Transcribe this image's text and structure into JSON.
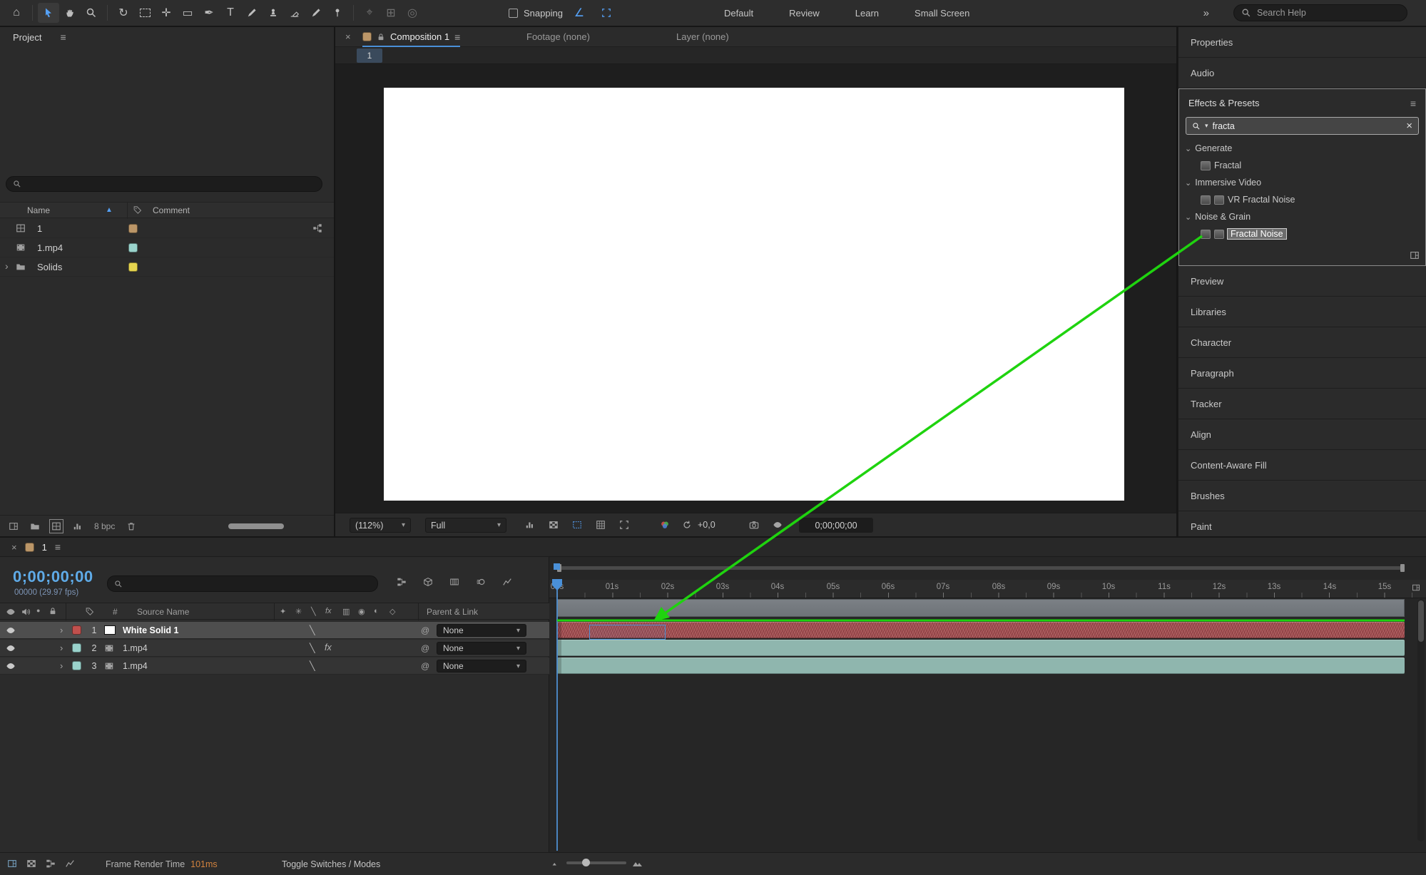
{
  "glyphs": {
    "close": "×",
    "menu": "≡",
    "chevron_right": "›",
    "chevron_down": "⌄",
    "caret_down": "▾",
    "sort_asc": "▲",
    "pickwhip": "@",
    "fx": "fx",
    "home": "⌂",
    "rotate": "↻",
    "pan_behind": "✛",
    "rectangle": "▭",
    "pen": "✒",
    "type": "T",
    "axis_a": "⌖",
    "axis_b": "⊞",
    "axis_c": "◎",
    "snap_angle": "∠",
    "quality": "╲",
    "solo": "●",
    "shy": "✦",
    "collapse_sun": "✳",
    "frame_blend": "▥",
    "motion_blur": "◉",
    "adjustment": "◐",
    "cube": "◇"
  },
  "toolbar": {
    "snapping_label": "Snapping",
    "workspaces": [
      "Default",
      "Review",
      "Learn",
      "Small Screen"
    ],
    "overflow": "»",
    "search_placeholder": "Search Help"
  },
  "project": {
    "title": "Project",
    "columns": {
      "name": "Name",
      "comment": "Comment"
    },
    "rows": [
      {
        "label": "1",
        "type": "composition",
        "label_color": "#bb9668"
      },
      {
        "label": "1.mp4",
        "type": "footage",
        "label_color": "#9ad3cc"
      },
      {
        "label": "Solids",
        "type": "folder",
        "label_color": "#e5d44f"
      }
    ],
    "footer": {
      "bpc": "8 bpc"
    }
  },
  "viewer": {
    "tabs": [
      {
        "label": "Composition 1",
        "active": true
      },
      {
        "label": "Footage (none)",
        "active": false
      },
      {
        "label": "Layer (none)",
        "active": false
      }
    ],
    "subtab": "1",
    "zoom": "(112%)",
    "resolution": "Full",
    "exposure": "+0,0",
    "timecode": "0;00;00;00"
  },
  "effects": {
    "panels_above": [
      "Properties",
      "Audio"
    ],
    "title": "Effects & Presets",
    "search_value": "fracta",
    "tree": [
      {
        "group": "Generate",
        "items": [
          "Fractal"
        ]
      },
      {
        "group": "Immersive Video",
        "items": [
          "VR Fractal Noise"
        ]
      },
      {
        "group": "Noise & Grain",
        "items": [
          "Fractal Noise"
        ]
      }
    ],
    "selected_item": "Fractal Noise",
    "panels_below": [
      "Preview",
      "Libraries",
      "Character",
      "Paragraph",
      "Tracker",
      "Align",
      "Content-Aware Fill",
      "Brushes",
      "Paint"
    ]
  },
  "timeline": {
    "tab_label": "1",
    "timecode": "0;00;00;00",
    "frame_info": "00000 (29.97 fps)",
    "columns": {
      "hash": "#",
      "source_name": "Source Name",
      "parent_link": "Parent & Link"
    },
    "layers": [
      {
        "num": "1",
        "name": "White Solid 1",
        "parent": "None",
        "label_color": "#c0504d",
        "bar_color": "#a65356",
        "selected": true
      },
      {
        "num": "2",
        "name": "1.mp4",
        "parent": "None",
        "label_color": "#9ad3cc",
        "bar_color": "#8fb6ae",
        "selected": false
      },
      {
        "num": "3",
        "name": "1.mp4",
        "parent": "None",
        "label_color": "#9ad3cc",
        "bar_color": "#8fb6ae",
        "selected": false
      }
    ],
    "ruler_ticks": [
      "00s",
      "01s",
      "02s",
      "03s",
      "04s",
      "05s",
      "06s",
      "07s",
      "08s",
      "09s",
      "10s",
      "11s",
      "12s",
      "13s",
      "14s",
      "15s"
    ],
    "status": {
      "frame_render_label": "Frame Render Time",
      "frame_render_value": "101ms",
      "toggle_modes_label": "Toggle Switches / Modes"
    }
  },
  "colors": {
    "accent_blue": "#4a90d8",
    "timecode_blue": "#5fabe8",
    "annotation_green": "#1fd30f",
    "bar_red": "#a65356",
    "bar_teal": "#8fb6ae"
  }
}
